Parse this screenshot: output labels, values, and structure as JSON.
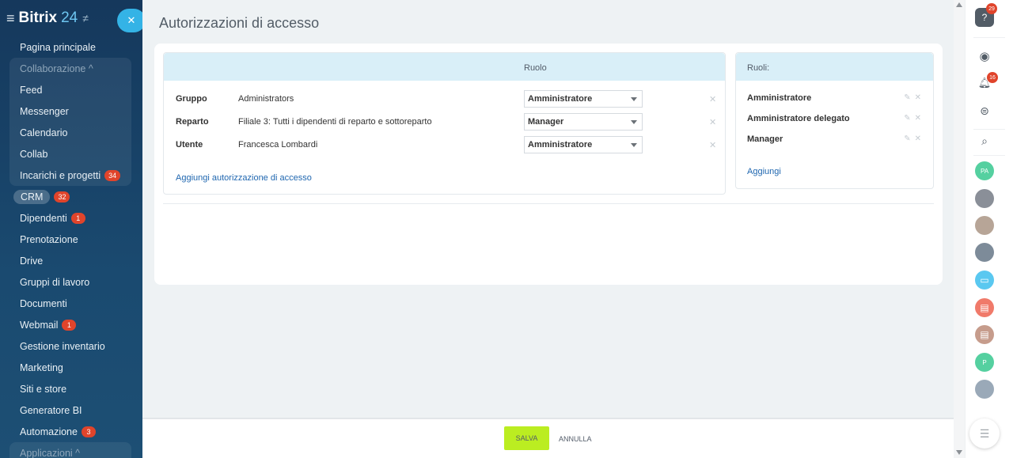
{
  "app": {
    "name": "Bitrix",
    "version": "24"
  },
  "sidebar": {
    "items": [
      {
        "label": "Pagina principale"
      },
      {
        "label": "Collaborazione ^",
        "group": true
      },
      {
        "label": "Feed"
      },
      {
        "label": "Messenger"
      },
      {
        "label": "Calendario"
      },
      {
        "label": "Collab"
      },
      {
        "label": "Incarichi e progetti",
        "badge": "34"
      },
      {
        "label": "CRM",
        "badge": "32"
      },
      {
        "label": "Dipendenti",
        "badge": "1"
      },
      {
        "label": "Prenotazione"
      },
      {
        "label": "Drive"
      },
      {
        "label": "Gruppi di lavoro"
      },
      {
        "label": "Documenti"
      },
      {
        "label": "Webmail",
        "badge": "1"
      },
      {
        "label": "Gestione inventario"
      },
      {
        "label": "Marketing"
      },
      {
        "label": "Siti e store"
      },
      {
        "label": "Generatore BI"
      },
      {
        "label": "Automazione",
        "badge": "3"
      },
      {
        "label": "Applicazioni ^",
        "group": true
      }
    ]
  },
  "page": {
    "title": "Autorizzazioni di accesso"
  },
  "permissions": {
    "header": "Ruolo",
    "rows": [
      {
        "type": "Gruppo",
        "name": "Administrators",
        "role": "Amministratore"
      },
      {
        "type": "Reparto",
        "name": "Filiale 3: Tutti i dipendenti di reparto e sottoreparto",
        "role": "Manager"
      },
      {
        "type": "Utente",
        "name": "Francesca Lombardi",
        "role": "Amministratore"
      }
    ],
    "add_label": "Aggiungi autorizzazione di accesso"
  },
  "roles": {
    "header": "Ruoli:",
    "items": [
      "Amministratore",
      "Amministratore delegato",
      "Manager"
    ],
    "add_label": "Aggiungi"
  },
  "footer": {
    "save_label": "SALVA",
    "cancel_label": "ANNULLA"
  },
  "rightbar": {
    "help_badge": "29",
    "notify_badge": "16",
    "avatar_initials": [
      "PA",
      "P"
    ]
  },
  "colors": {
    "accent": "#bbed21",
    "link": "#2067b0",
    "header_bg": "#d9eff8",
    "badge": "#e0442b"
  }
}
